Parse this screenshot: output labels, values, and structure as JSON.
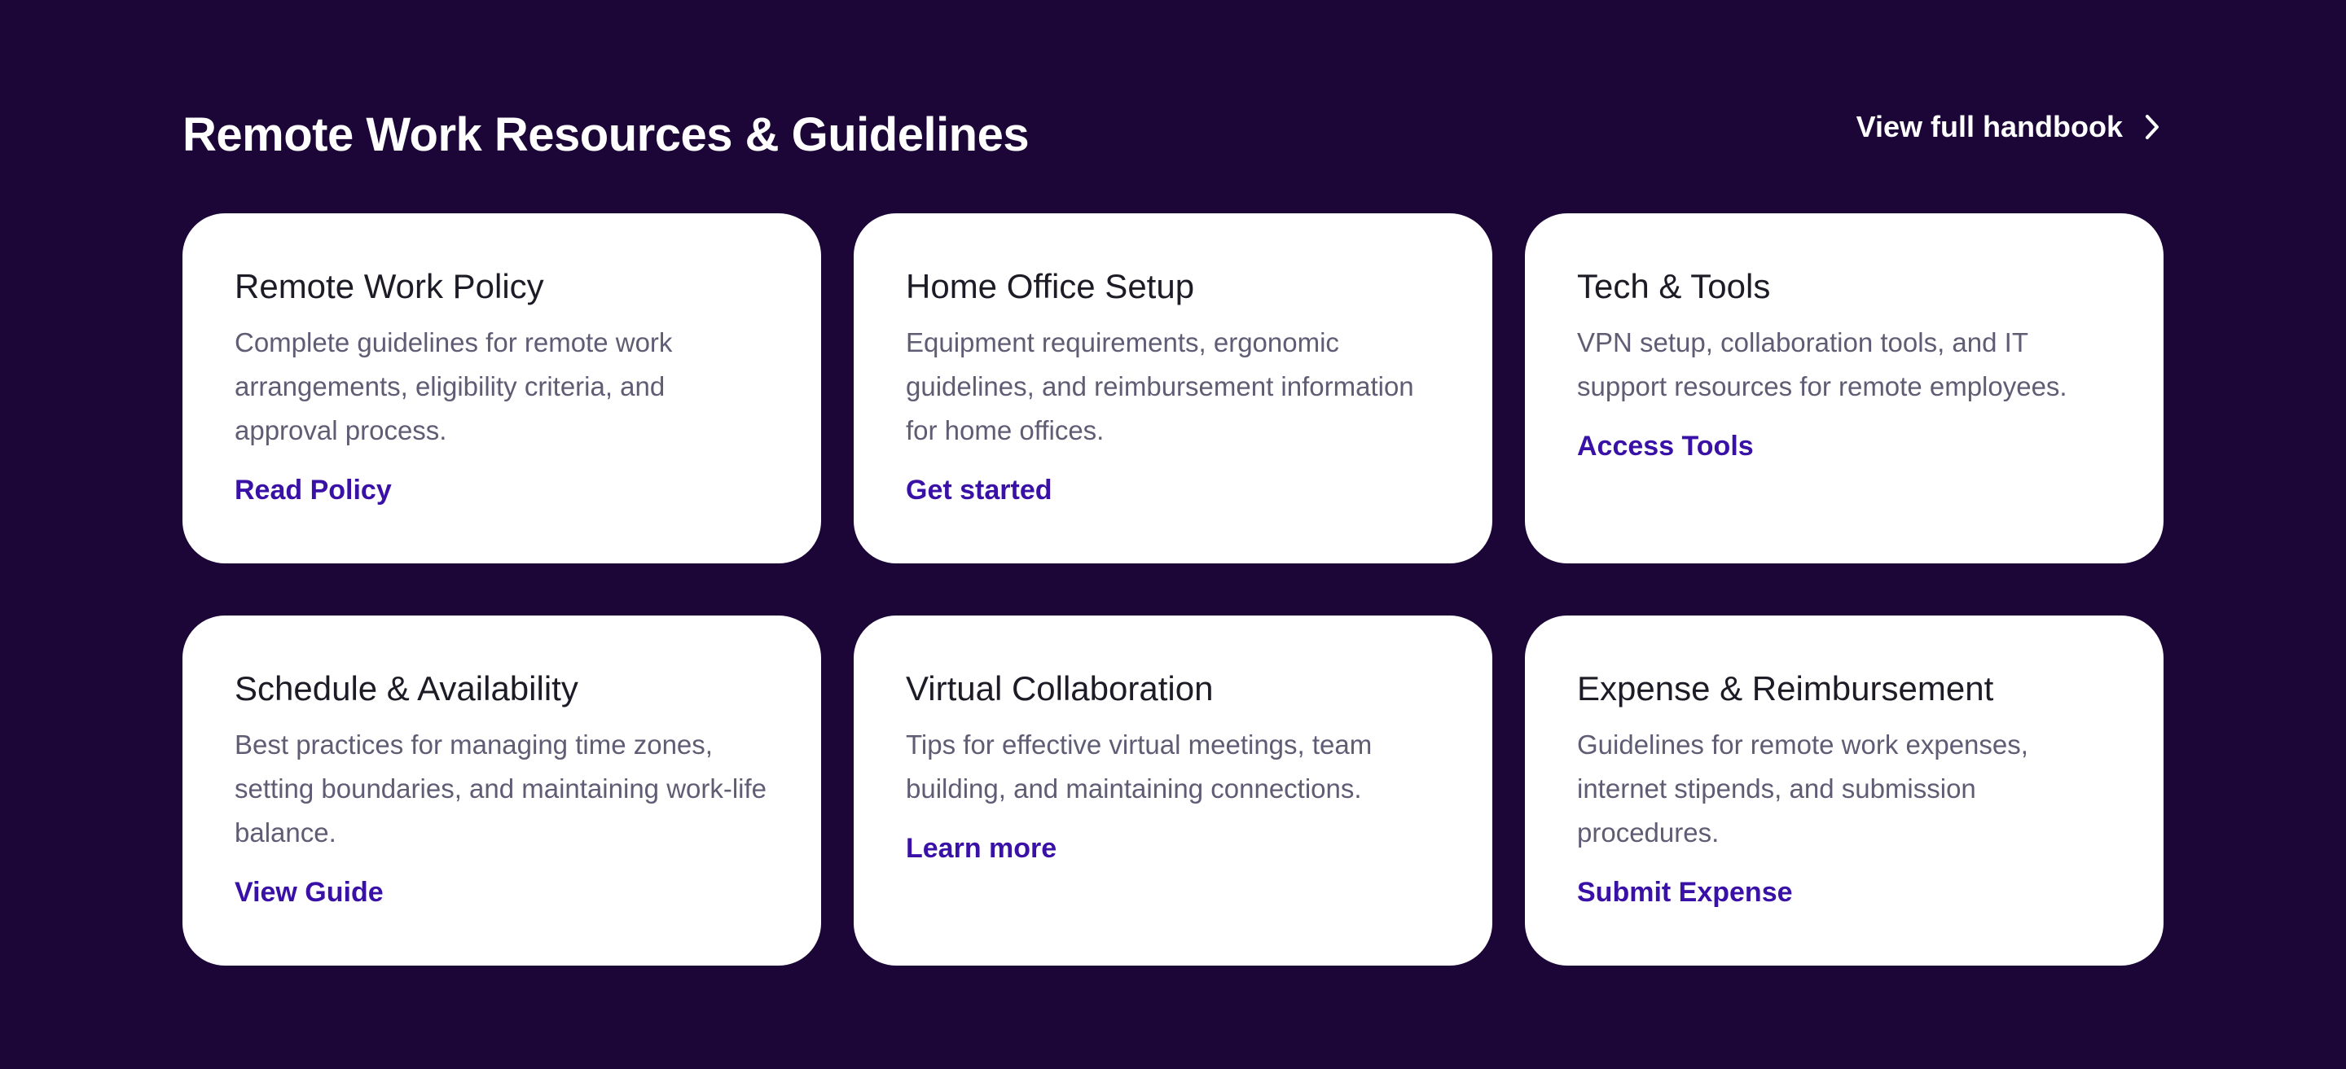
{
  "section": {
    "title": "Remote Work Resources & Guidelines",
    "handbook_link": "View full handbook",
    "handbook_icon": "chevron-right-icon"
  },
  "colors": {
    "background": "#1c0638",
    "card": "#ffffff",
    "link": "#3a11a6",
    "heading": "#1d1b26",
    "body_text": "#5f5c74"
  },
  "cards": [
    {
      "title": "Remote Work Policy",
      "description": "Complete guidelines for remote work arrangements, eligibility criteria, and approval process.",
      "link": "Read Policy"
    },
    {
      "title": "Home Office Setup",
      "description": "Equipment requirements, ergonomic guidelines, and reimbursement information for home offices.",
      "link": "Get started"
    },
    {
      "title": "Tech & Tools",
      "description": "VPN setup, collaboration tools, and IT support resources for remote employees.",
      "link": "Access Tools"
    },
    {
      "title": "Schedule & Availability",
      "description": "Best practices for managing time zones, setting boundaries, and maintaining work-life balance.",
      "link": "View Guide"
    },
    {
      "title": "Virtual Collaboration",
      "description": "Tips for effective virtual meetings, team building, and maintaining connections.",
      "link": "Learn more"
    },
    {
      "title": "Expense & Reimbursement",
      "description": "Guidelines for remote work expenses, internet stipends, and submission procedures.",
      "link": "Submit Expense"
    }
  ]
}
